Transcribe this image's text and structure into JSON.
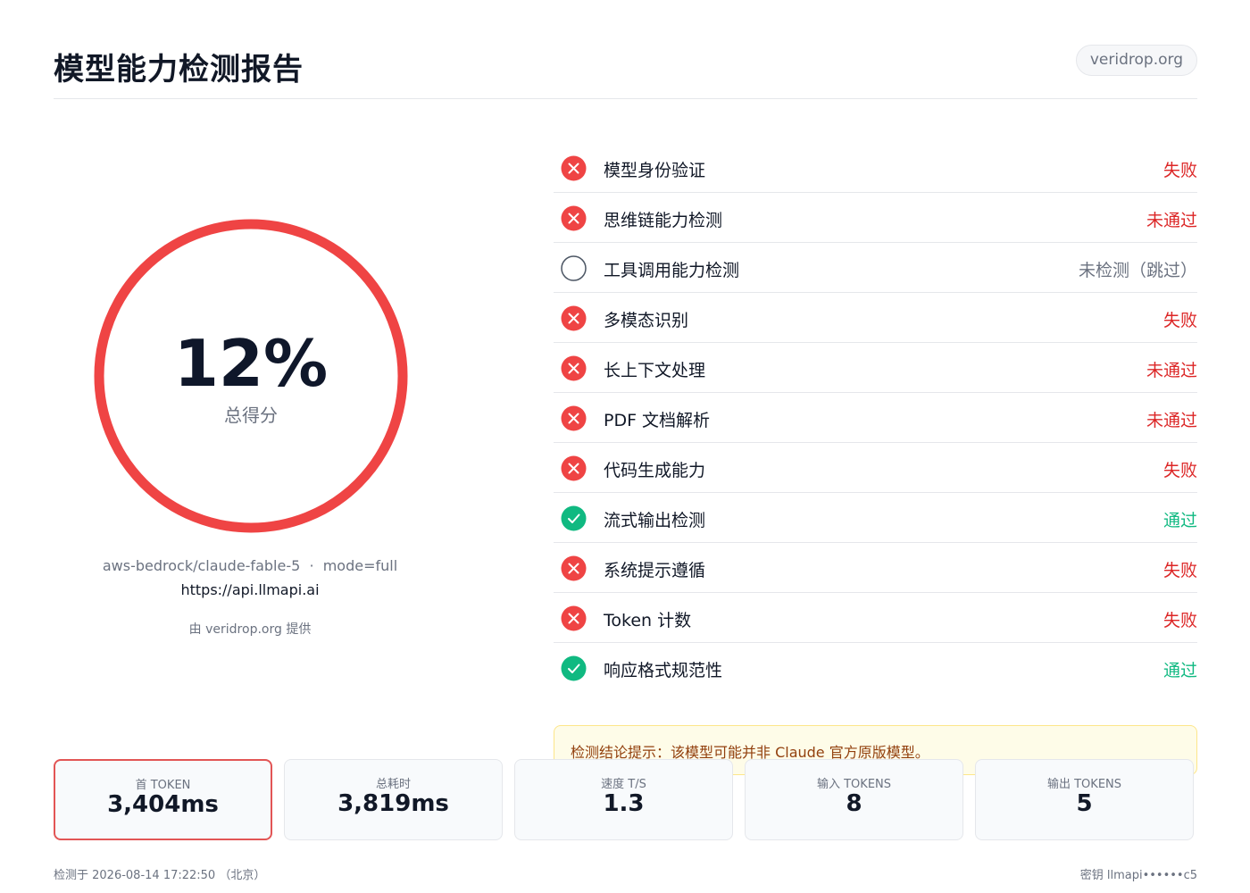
{
  "header": {
    "title": "模型能力检测报告",
    "domain": "veridrop.org"
  },
  "score": {
    "value": "12%",
    "fraction": 0.12,
    "label": "总得分",
    "ring_color": "#ef4444"
  },
  "model": {
    "info": "aws-bedrock/claude-fable-5  ·  mode=full",
    "endpoint": "https://api.llmapi.ai",
    "powered_by": "由 veridrop.org 提供"
  },
  "checks": [
    {
      "name": "模型身份验证",
      "result": "失败",
      "status": "fail",
      "icon": "x-circle-icon"
    },
    {
      "name": "思维链能力检测",
      "result": "未通过",
      "status": "fail",
      "icon": "x-circle-icon"
    },
    {
      "name": "工具调用能力检测",
      "result": "未检测（跳过）",
      "status": "skip",
      "icon": "empty-circle-icon"
    },
    {
      "name": "多模态识别",
      "result": "失败",
      "status": "fail",
      "icon": "x-circle-icon"
    },
    {
      "name": "长上下文处理",
      "result": "未通过",
      "status": "fail",
      "icon": "x-circle-icon"
    },
    {
      "name": "PDF 文档解析",
      "result": "未通过",
      "status": "fail",
      "icon": "x-circle-icon"
    },
    {
      "name": "代码生成能力",
      "result": "失败",
      "status": "fail",
      "icon": "x-circle-icon"
    },
    {
      "name": "流式输出检测",
      "result": "通过",
      "status": "pass",
      "icon": "check-circle-icon"
    },
    {
      "name": "系统提示遵循",
      "result": "失败",
      "status": "fail",
      "icon": "x-circle-icon"
    },
    {
      "name": "Token 计数",
      "result": "失败",
      "status": "fail",
      "icon": "x-circle-icon"
    },
    {
      "name": "响应格式规范性",
      "result": "通过",
      "status": "pass",
      "icon": "check-circle-icon"
    }
  ],
  "notice": "检测结论提示：该模型可能并非 Claude 官方原版模型。",
  "stats": [
    {
      "label": "首 TOKEN",
      "value": "3,404ms",
      "highlight": true
    },
    {
      "label": "总耗时",
      "value": "3,819ms"
    },
    {
      "label": "速度 T/S",
      "value": "1.3"
    },
    {
      "label": "输入 TOKENS",
      "value": "8"
    },
    {
      "label": "输出 TOKENS",
      "value": "5"
    }
  ],
  "footer": {
    "left": "检测于 2026-08-14 17:22:50 （北京）",
    "right": "密钥 llmapi••••••c5"
  },
  "colors": {
    "fail": "#ef4444",
    "pass": "#10b981",
    "skip": "#4b5563"
  }
}
